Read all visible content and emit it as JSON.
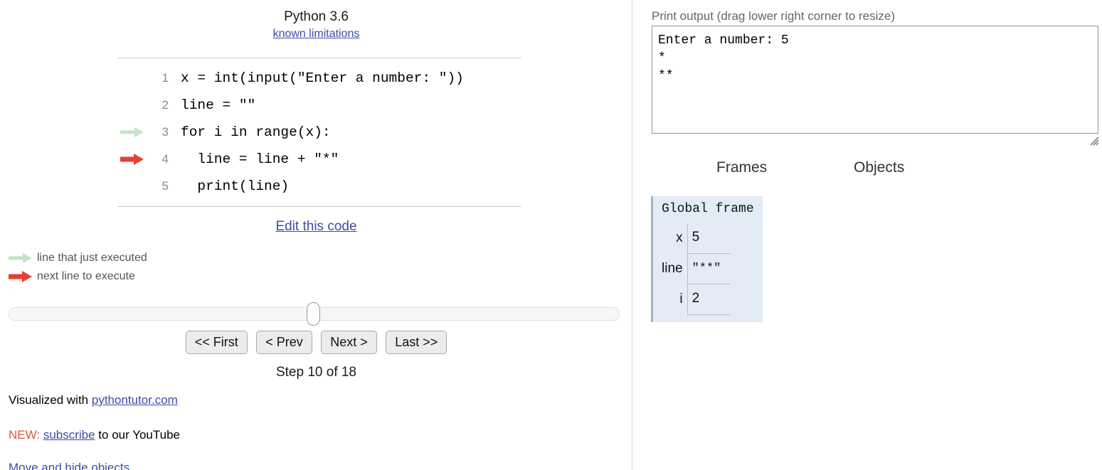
{
  "language": {
    "name": "Python 3.6",
    "limitations_link": "known limitations"
  },
  "code": {
    "lines": [
      {
        "num": "1",
        "text": "x = int(input(\"Enter a number: \"))",
        "arrow": "none"
      },
      {
        "num": "2",
        "text": "line = \"\"",
        "arrow": "none"
      },
      {
        "num": "3",
        "text": "for i in range(x):",
        "arrow": "green"
      },
      {
        "num": "4",
        "text": "  line = line + \"*\"",
        "arrow": "red"
      },
      {
        "num": "5",
        "text": "  print(line)",
        "arrow": "none"
      }
    ],
    "edit_link": "Edit this code"
  },
  "legend": [
    {
      "icon": "green-arrow-icon",
      "label": "line that just executed"
    },
    {
      "icon": "red-arrow-icon",
      "label": "next line to execute"
    }
  ],
  "controls": {
    "first_label": "<< First",
    "prev_label": "< Prev",
    "next_label": "Next >",
    "last_label": "Last >>",
    "step_text": "Step 10 of 18",
    "step_current": 10,
    "step_total": 18,
    "slider_position_percent": 50
  },
  "credits": {
    "visualized_with_prefix": "Visualized with ",
    "site_link": "pythontutor.com",
    "new_tag": "NEW:",
    "subscribe_link": "subscribe",
    "subscribe_suffix": " to our YouTube",
    "more_link": "Move and hide objects"
  },
  "output": {
    "label": "Print output (drag lower right corner to resize)",
    "text": "Enter a number: 5\n*\n**"
  },
  "panels": {
    "frames_heading": "Frames",
    "objects_heading": "Objects"
  },
  "frames": [
    {
      "title": "Global frame",
      "variables": [
        {
          "name": "x",
          "value": "5",
          "mono": false
        },
        {
          "name": "line",
          "value": "\"**\"",
          "mono": true
        },
        {
          "name": "i",
          "value": "2",
          "mono": false
        }
      ]
    }
  ],
  "colors": {
    "link": "#3d4ca8",
    "green_arrow": "#c3e5c3",
    "red_arrow": "#e8402f",
    "frame_bg": "#e2ebf6",
    "frame_border": "#a6b3c2",
    "new_tag": "#e8503a",
    "button_bg": "#ececec"
  }
}
